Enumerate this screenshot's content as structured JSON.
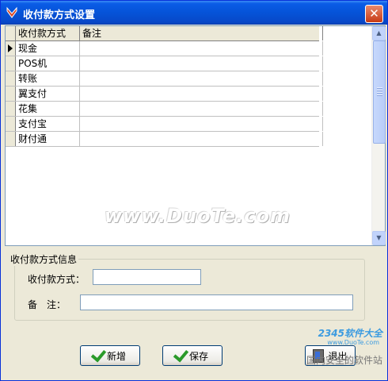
{
  "window": {
    "title": "收付款方式设置",
    "close": "✕"
  },
  "grid": {
    "columns": [
      "收付款方式",
      "备注"
    ],
    "rows": [
      {
        "name": "现金",
        "note": ""
      },
      {
        "name": "POS机",
        "note": ""
      },
      {
        "name": "转账",
        "note": ""
      },
      {
        "name": "翼支付",
        "note": ""
      },
      {
        "name": "花集",
        "note": ""
      },
      {
        "name": "支付宝",
        "note": ""
      },
      {
        "name": "财付通",
        "note": ""
      }
    ],
    "selected_row": 0
  },
  "watermark": "www.DuoTe.com",
  "info": {
    "group_title": "收付款方式信息",
    "method_label": "收付款方式：",
    "method_value": "",
    "note_label": "备　注：",
    "note_value": ""
  },
  "buttons": {
    "add": "新增",
    "save": "保存",
    "exit": "退出"
  },
  "corner_watermark": {
    "brand": "2345软件大全",
    "url": "www.DuoTe.com",
    "tagline": "国内安全的软件站"
  },
  "colors": {
    "title_bar": "#0553d8",
    "accent_check": "#2a9a2a",
    "close": "#c73a15"
  }
}
